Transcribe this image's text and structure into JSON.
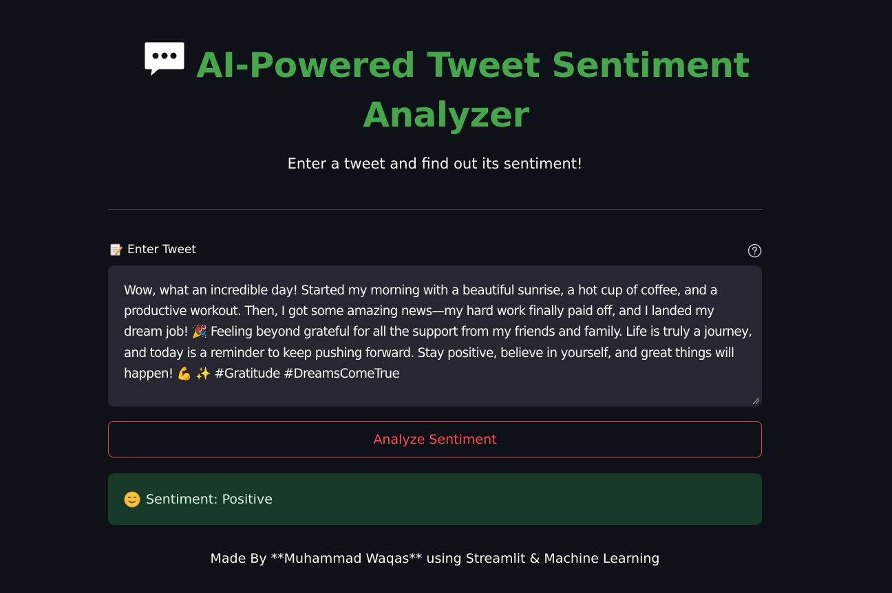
{
  "header": {
    "title": "AI-Powered Tweet Sentiment Analyzer",
    "title_icon": "speech-balloon-icon",
    "subtitle": "Enter a tweet and find out its sentiment!"
  },
  "input": {
    "label": "Enter Tweet",
    "label_icon": "memo-icon",
    "help_icon": "help-circle-icon",
    "value": "Wow, what an incredible day! Started my morning with a beautiful sunrise, a hot cup of coffee, and a productive workout. Then, I got some amazing news—my hard work finally paid off, and I landed my dream job! 🎉 Feeling beyond grateful for all the support from my friends and family. Life is truly a journey, and today is a reminder to keep pushing forward. Stay positive, believe in yourself, and great things will happen! 💪 ✨ #Gratitude #DreamsComeTrue"
  },
  "button": {
    "label": "Analyze Sentiment"
  },
  "result": {
    "icon": "smiling-face-icon",
    "text": "Sentiment: Positive"
  },
  "footer": {
    "text": "Made By **Muhammad Waqas** using Streamlit & Machine Learning"
  },
  "colors": {
    "background": "#0e1117",
    "title": "#44a84a",
    "input_bg": "#262730",
    "button_accent": "#ff4b4b",
    "success_bg": "#173928"
  }
}
